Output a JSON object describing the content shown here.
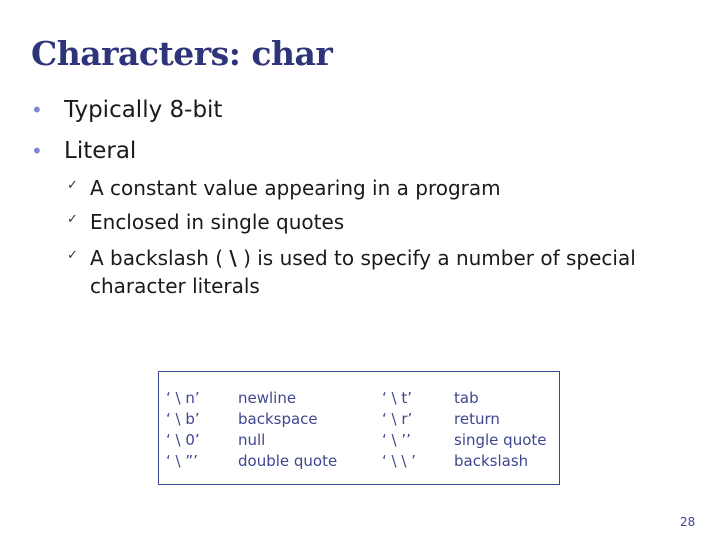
{
  "slide": {
    "title": "Characters: char",
    "bullets": [
      {
        "text": "Typically 8-bit"
      },
      {
        "text": "Literal"
      }
    ],
    "sub_bullets": [
      {
        "text": "A constant value appearing in a program"
      },
      {
        "text": "Enclosed in single quotes"
      },
      {
        "before": "A backslash ( ",
        "symbol": "\\",
        "after": " ) is used to specify a number of special character literals"
      }
    ],
    "bullet_icon": "bullet-dot-icon",
    "check_icon": "checkmark-icon",
    "page_number": "28"
  },
  "escape_table": {
    "rows": [
      {
        "code1": "‘ \\ n’",
        "desc1": "newline",
        "code2": "‘ \\ t’",
        "desc2": "tab"
      },
      {
        "code1": "‘ \\ b’",
        "desc1": "backspace",
        "code2": "‘ \\ r’",
        "desc2": "return"
      },
      {
        "code1": "‘ \\ 0’",
        "desc1": "null",
        "code2": "‘ \\ ’’",
        "desc2": "single quote"
      },
      {
        "code1": "‘ \\ ”’",
        "desc1": "double quote",
        "code2": "‘ \\  \\ ’",
        "desc2": "backslash"
      }
    ]
  },
  "colors": {
    "title": "#2e3479",
    "bullet": "#7f86d1",
    "table": "#3f4690",
    "text": "#1a1a1a"
  }
}
